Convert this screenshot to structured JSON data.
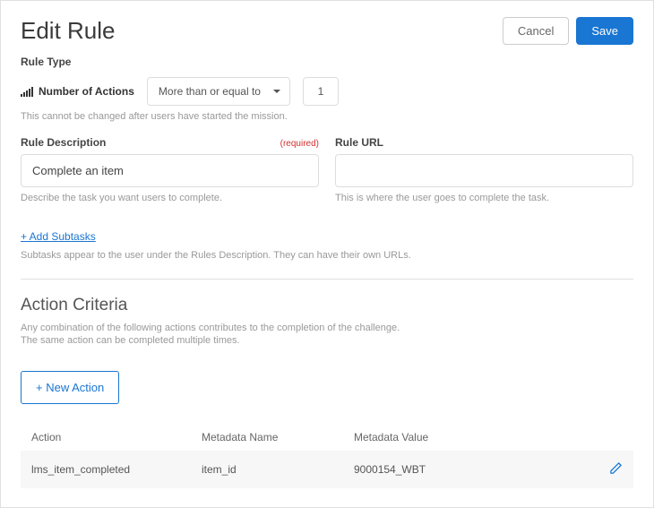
{
  "header": {
    "title": "Edit Rule",
    "cancel_label": "Cancel",
    "save_label": "Save"
  },
  "rule_type": {
    "section_label": "Rule Type",
    "name": "Number of Actions",
    "operator": "More than or equal to",
    "value": "1",
    "help": "This cannot be changed after users have started the mission."
  },
  "description": {
    "label": "Rule Description",
    "required_text": "(required)",
    "value": "Complete an item",
    "help": "Describe the task you want users to complete."
  },
  "url": {
    "label": "Rule URL",
    "value": "",
    "help": "This is where the user goes to complete the task."
  },
  "subtasks": {
    "add_link": "+ Add Subtasks",
    "help": "Subtasks appear to the user under the Rules Description. They can have their own URLs."
  },
  "criteria": {
    "title": "Action Criteria",
    "help_line1": "Any combination of the following actions contributes to the completion of the challenge.",
    "help_line2": "The same action can be completed multiple times.",
    "new_action_label": "+ New Action",
    "columns": {
      "action": "Action",
      "meta_name": "Metadata Name",
      "meta_value": "Metadata Value"
    },
    "rows": [
      {
        "action": "lms_item_completed",
        "meta_name": "item_id",
        "meta_value": "9000154_WBT"
      }
    ]
  }
}
